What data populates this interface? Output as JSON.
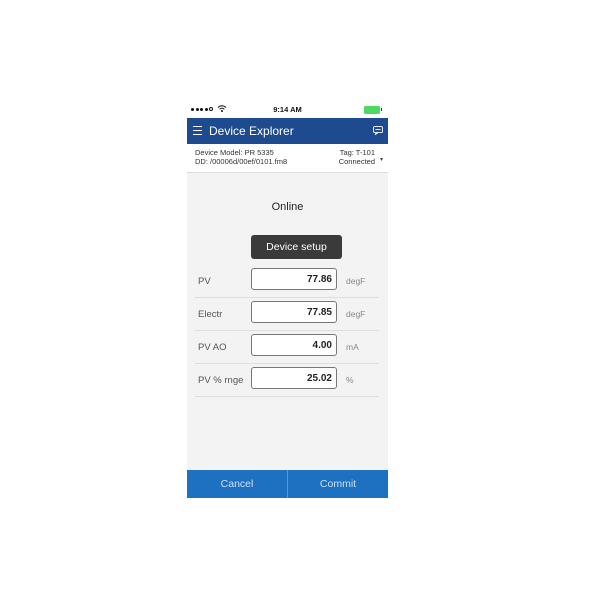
{
  "status_bar": {
    "time": "9:14 AM"
  },
  "header": {
    "title": "Device Explorer"
  },
  "device_info": {
    "model": "Device Model:  PR 5335",
    "dd": "DD:  /00006d/00ef/0101.fm8",
    "tag": "Tag:  T-101",
    "connection": "Connected"
  },
  "main": {
    "section_title": "Online",
    "setup_button": "Device setup",
    "rows": [
      {
        "label": "PV",
        "value": "77.86",
        "unit": "degF"
      },
      {
        "label": "Electr",
        "value": "77.85",
        "unit": "degF"
      },
      {
        "label": "PV AO",
        "value": "4.00",
        "unit": "mA"
      },
      {
        "label": "PV % rnge",
        "value": "25.02",
        "unit": "%"
      }
    ]
  },
  "footer": {
    "cancel": "Cancel",
    "commit": "Commit"
  },
  "colors": {
    "header": "#1e4b8f",
    "footer": "#1e70c0",
    "battery": "#4cd964",
    "setup_button": "#3a3a3a"
  }
}
